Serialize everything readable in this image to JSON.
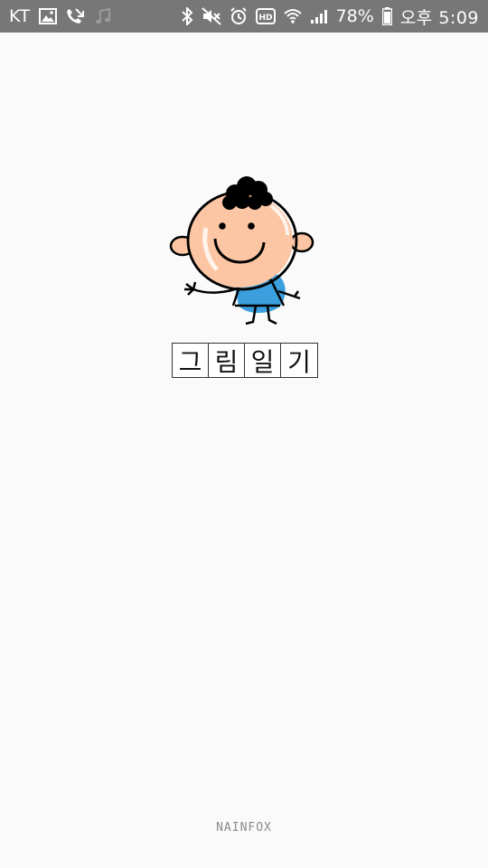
{
  "status_bar": {
    "carrier": "KT",
    "battery": "78%",
    "time": "오후 5:09",
    "icons": [
      "image-icon",
      "call-forward-icon",
      "music-note-icon",
      "bluetooth-icon",
      "mute-icon",
      "alarm-icon",
      "hd-icon",
      "wifi-icon",
      "signal-icon",
      "battery-icon"
    ]
  },
  "splash": {
    "title_chars": [
      "그",
      "림",
      "일",
      "기"
    ],
    "mascot_icon": "waving-cartoon-boy",
    "brand": "NAINFOX"
  },
  "colors": {
    "status_bar_bg": "#777777",
    "background": "#fafafa",
    "skin": "#fcc6a4",
    "shirt": "#3a9fdc",
    "hair": "#000000"
  }
}
